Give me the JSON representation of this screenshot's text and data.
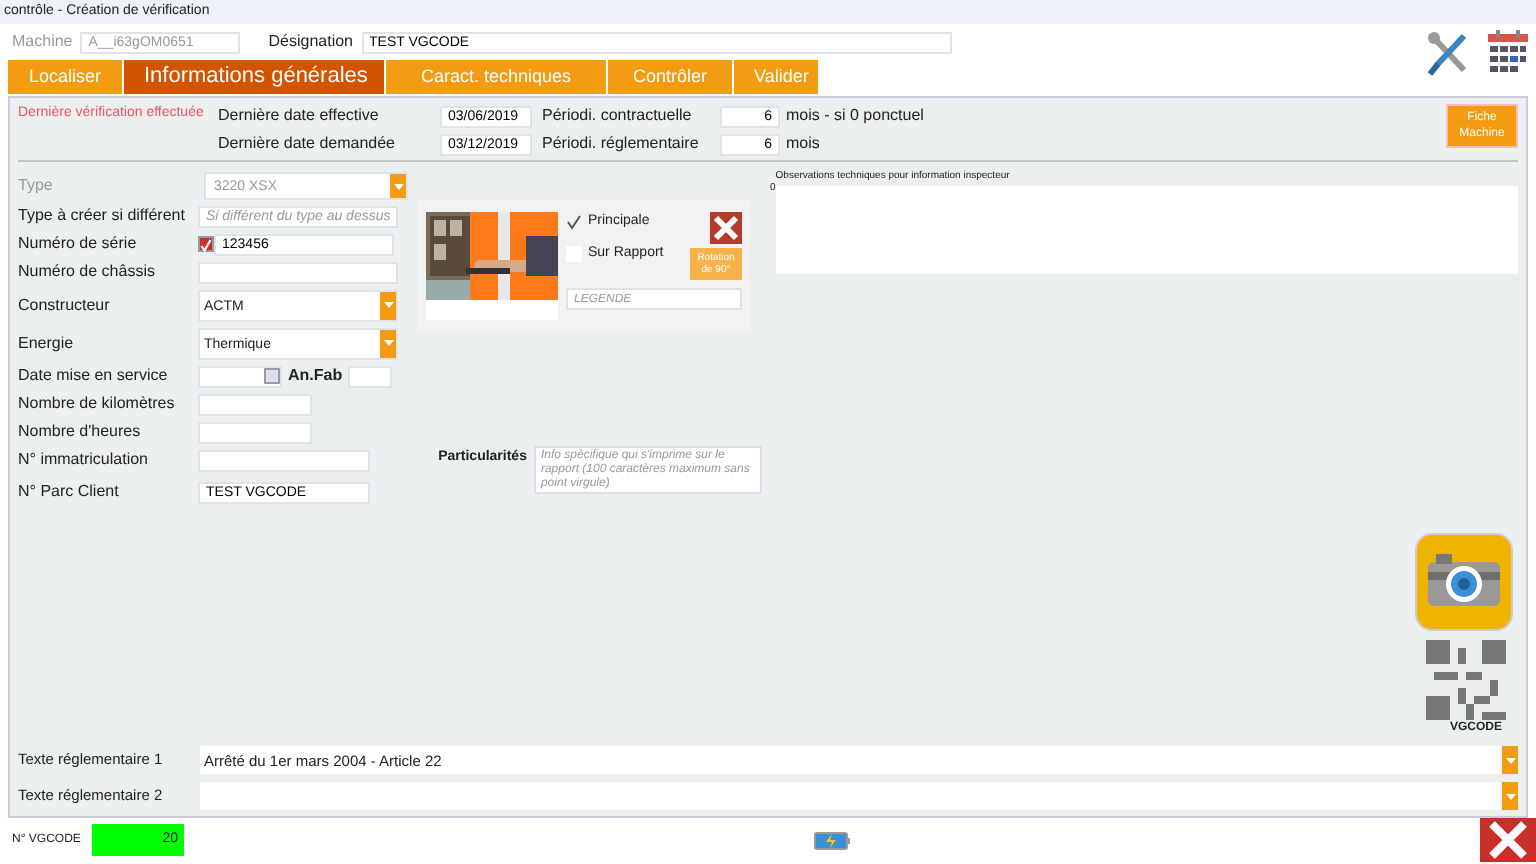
{
  "window": {
    "title": "contrôle - Création de vérification"
  },
  "header": {
    "machine": {
      "label": "Machine",
      "value": "A__i63gOM0651",
      "disabled": true
    },
    "designation": {
      "label": "Désignation",
      "value": "TEST VGCODE"
    }
  },
  "tabs": [
    {
      "label": "Localiser",
      "selected": false
    },
    {
      "label": "Informations générales",
      "selected": true
    },
    {
      "label": "Caract. techniques",
      "selected": false
    },
    {
      "label": "Contrôler",
      "selected": false
    },
    {
      "label": "Valider",
      "selected": false
    }
  ],
  "last_check": {
    "title": "Dernière vérification effectuée",
    "rows": [
      {
        "label": "Dernière date effective",
        "date": "03/06/2019",
        "period_label": "Périodi. contractuelle",
        "period": "6",
        "unit": "mois - si 0 ponctuel"
      },
      {
        "label": "Dernière date demandée",
        "date": "03/12/2019",
        "period_label": "Périodi. réglementaire",
        "period": "6",
        "unit": "mois"
      }
    ]
  },
  "fiche_button": "Fiche Machine",
  "type": {
    "label": "Type",
    "value": "3220 XSX",
    "disabled": true
  },
  "fields": [
    {
      "label": "Type à créer si différent",
      "kind": "text",
      "placeholder": "Si différent du type au dessus"
    },
    {
      "label": "Numéro de série",
      "kind": "check",
      "checked": true,
      "value": "123456"
    },
    {
      "label": "Numéro de châssis",
      "kind": "text"
    },
    {
      "label": "Constructeur",
      "kind": "select",
      "value": "ACTM"
    },
    {
      "label": "Energie",
      "kind": "select",
      "value": "Thermique"
    },
    {
      "label": "Date mise en service",
      "kind": "date",
      "extra_label": "An.Fab"
    },
    {
      "label": "Nombre de kilomètres",
      "kind": "short"
    },
    {
      "label": "Nombre d'heures",
      "kind": "short"
    },
    {
      "label": "N° immatriculation",
      "kind": "wide"
    },
    {
      "label": "N° Parc Client",
      "kind": "wide",
      "value": "TEST VGCODE"
    }
  ],
  "particularites": {
    "label": "Particularités",
    "placeholder": "Info spécifique qui s'imprime sur le rapport (100 caractères maximum sans point virgule)"
  },
  "photo": {
    "options": [
      {
        "label": "Principale",
        "checked": true
      },
      {
        "label": "Sur Rapport",
        "checked": false
      }
    ],
    "rotate_button": "Rotation de 90°",
    "caption_placeholder": "LEGENDE"
  },
  "observations": {
    "label": "Observations techniques pour information inspecteur",
    "counter": "0"
  },
  "vgcode_caption": "VGCODE",
  "texts": [
    {
      "label": "Texte réglementaire 1",
      "value": "Arrêté du 1er mars 2004 - Article 22"
    },
    {
      "label": "Texte réglementaire 2"
    }
  ],
  "footer": {
    "vgcode_label": "N° VGCODE",
    "vgcode": "20"
  }
}
